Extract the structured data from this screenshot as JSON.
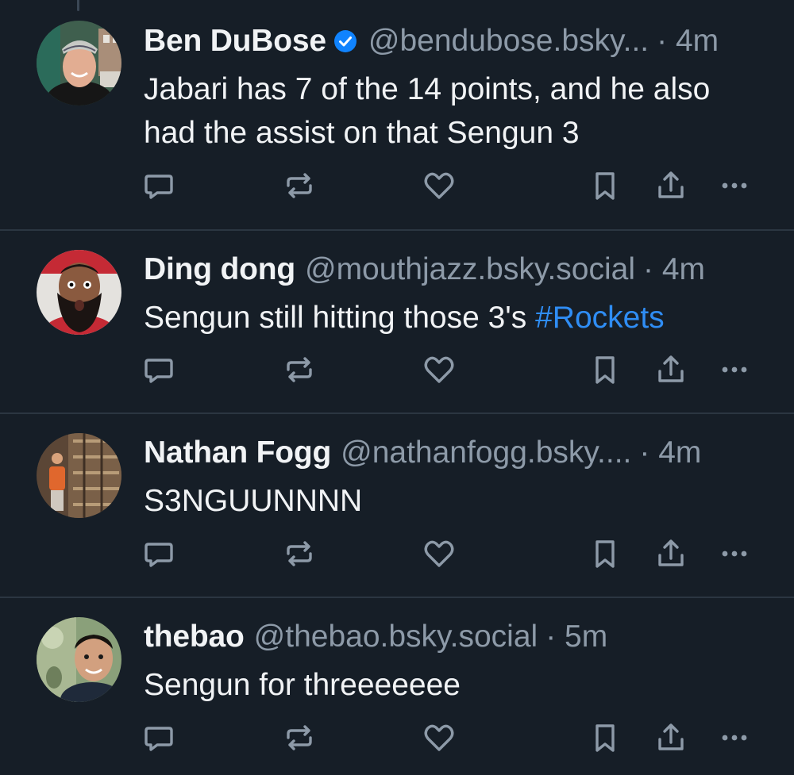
{
  "posts": [
    {
      "display_name": "Ben DuBose",
      "verified": true,
      "handle": "@bendubose.bsky...",
      "timestamp": "· 4m",
      "text": "Jabari has 7 of the 14 points, and he also had the assist on that Sengun 3",
      "hashtag": ""
    },
    {
      "display_name": "Ding dong",
      "verified": false,
      "handle": "@mouthjazz.bsky.social",
      "timestamp": "· 4m",
      "text": "Sengun still hitting those 3's ",
      "hashtag": "#Rockets"
    },
    {
      "display_name": "Nathan Fogg",
      "verified": false,
      "handle": "@nathanfogg.bsky....",
      "timestamp": "· 4m",
      "text": "S3NGUUNNNN",
      "hashtag": ""
    },
    {
      "display_name": "thebao",
      "verified": false,
      "handle": "@thebao.bsky.social",
      "timestamp": "· 5m",
      "text": "Sengun for threeeeeee",
      "hashtag": ""
    }
  ],
  "icons": {
    "reply": "reply-icon",
    "repost": "repost-icon",
    "like": "like-icon",
    "bookmark": "bookmark-icon",
    "share": "share-icon",
    "more": "more-icon",
    "verified": "verified-check-icon"
  },
  "colors": {
    "background": "#161e27",
    "divider": "#2b3641",
    "primary_text": "#f1f3f5",
    "secondary_text": "#8d9aa8",
    "icon": "#8d9aa8",
    "hashtag": "#2f8df4",
    "verified_badge": "#1083fe"
  }
}
